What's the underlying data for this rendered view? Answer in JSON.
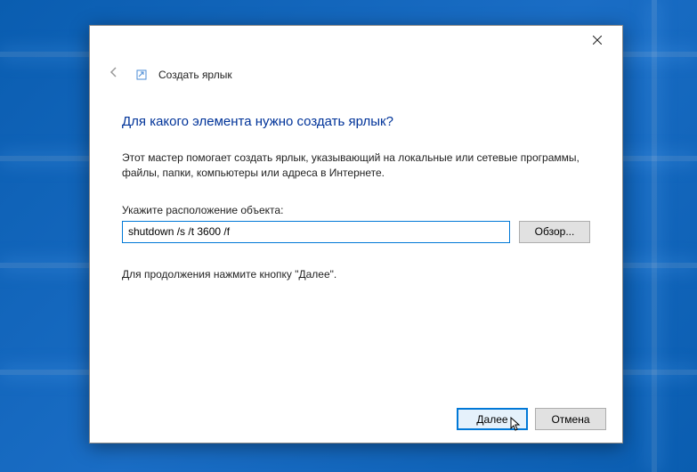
{
  "wizard": {
    "title": "Создать ярлык",
    "heading": "Для какого элемента нужно создать ярлык?",
    "description": "Этот мастер помогает создать ярлык, указывающий на локальные или сетевые программы, файлы, папки, компьютеры или адреса в Интернете.",
    "field_label": "Укажите расположение объекта:",
    "location_value": "shutdown /s /t 3600 /f",
    "browse_label": "Обзор...",
    "continue_text": "Для продолжения нажмите кнопку \"Далее\".",
    "next_label": "Далее",
    "cancel_label": "Отмена"
  }
}
